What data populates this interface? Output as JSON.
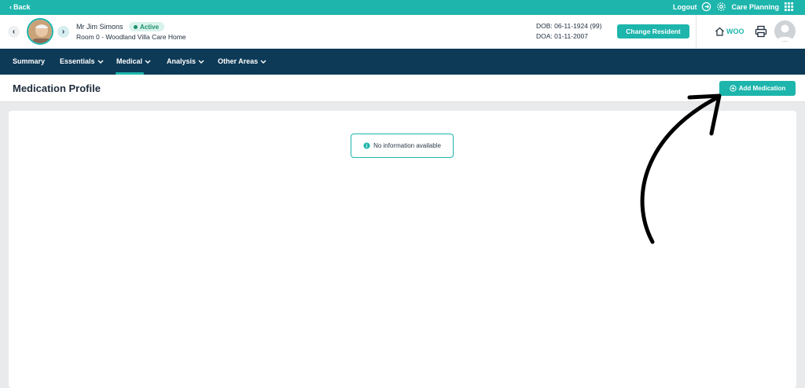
{
  "topbar": {
    "back_label": "Back",
    "logout_label": "Logout",
    "care_planning_label": "Care Planning"
  },
  "resident": {
    "name": "Mr Jim Simons",
    "status": "Active",
    "room": "Room 0 - Woodland Villa Care Home",
    "dob": "DOB: 06-11-1924 (99)",
    "doa": "DOA: 01-11-2007",
    "change_label": "Change Resident"
  },
  "home": {
    "label": "WOO"
  },
  "menu": {
    "summary": "Summary",
    "essentials": "Essentials",
    "medical": "Medical",
    "analysis": "Analysis",
    "other_areas": "Other Areas"
  },
  "page": {
    "title": "Medication Profile",
    "add_label": "Add Medication",
    "empty_message": "No information available"
  },
  "colors": {
    "accent": "#1db5ac",
    "nav_bg": "#0d3a57",
    "status_bg": "#d8f2ec",
    "status_text": "#1a8f6a"
  },
  "icons": {
    "back": "chevron-left-icon",
    "logout": "logout-icon",
    "settings": "gear-icon",
    "apps": "grid-icon",
    "home": "home-icon",
    "print": "printer-icon",
    "user": "user-avatar-icon",
    "add": "plus-circle-icon",
    "info": "info-icon",
    "annotation": "curved-arrow-icon"
  }
}
